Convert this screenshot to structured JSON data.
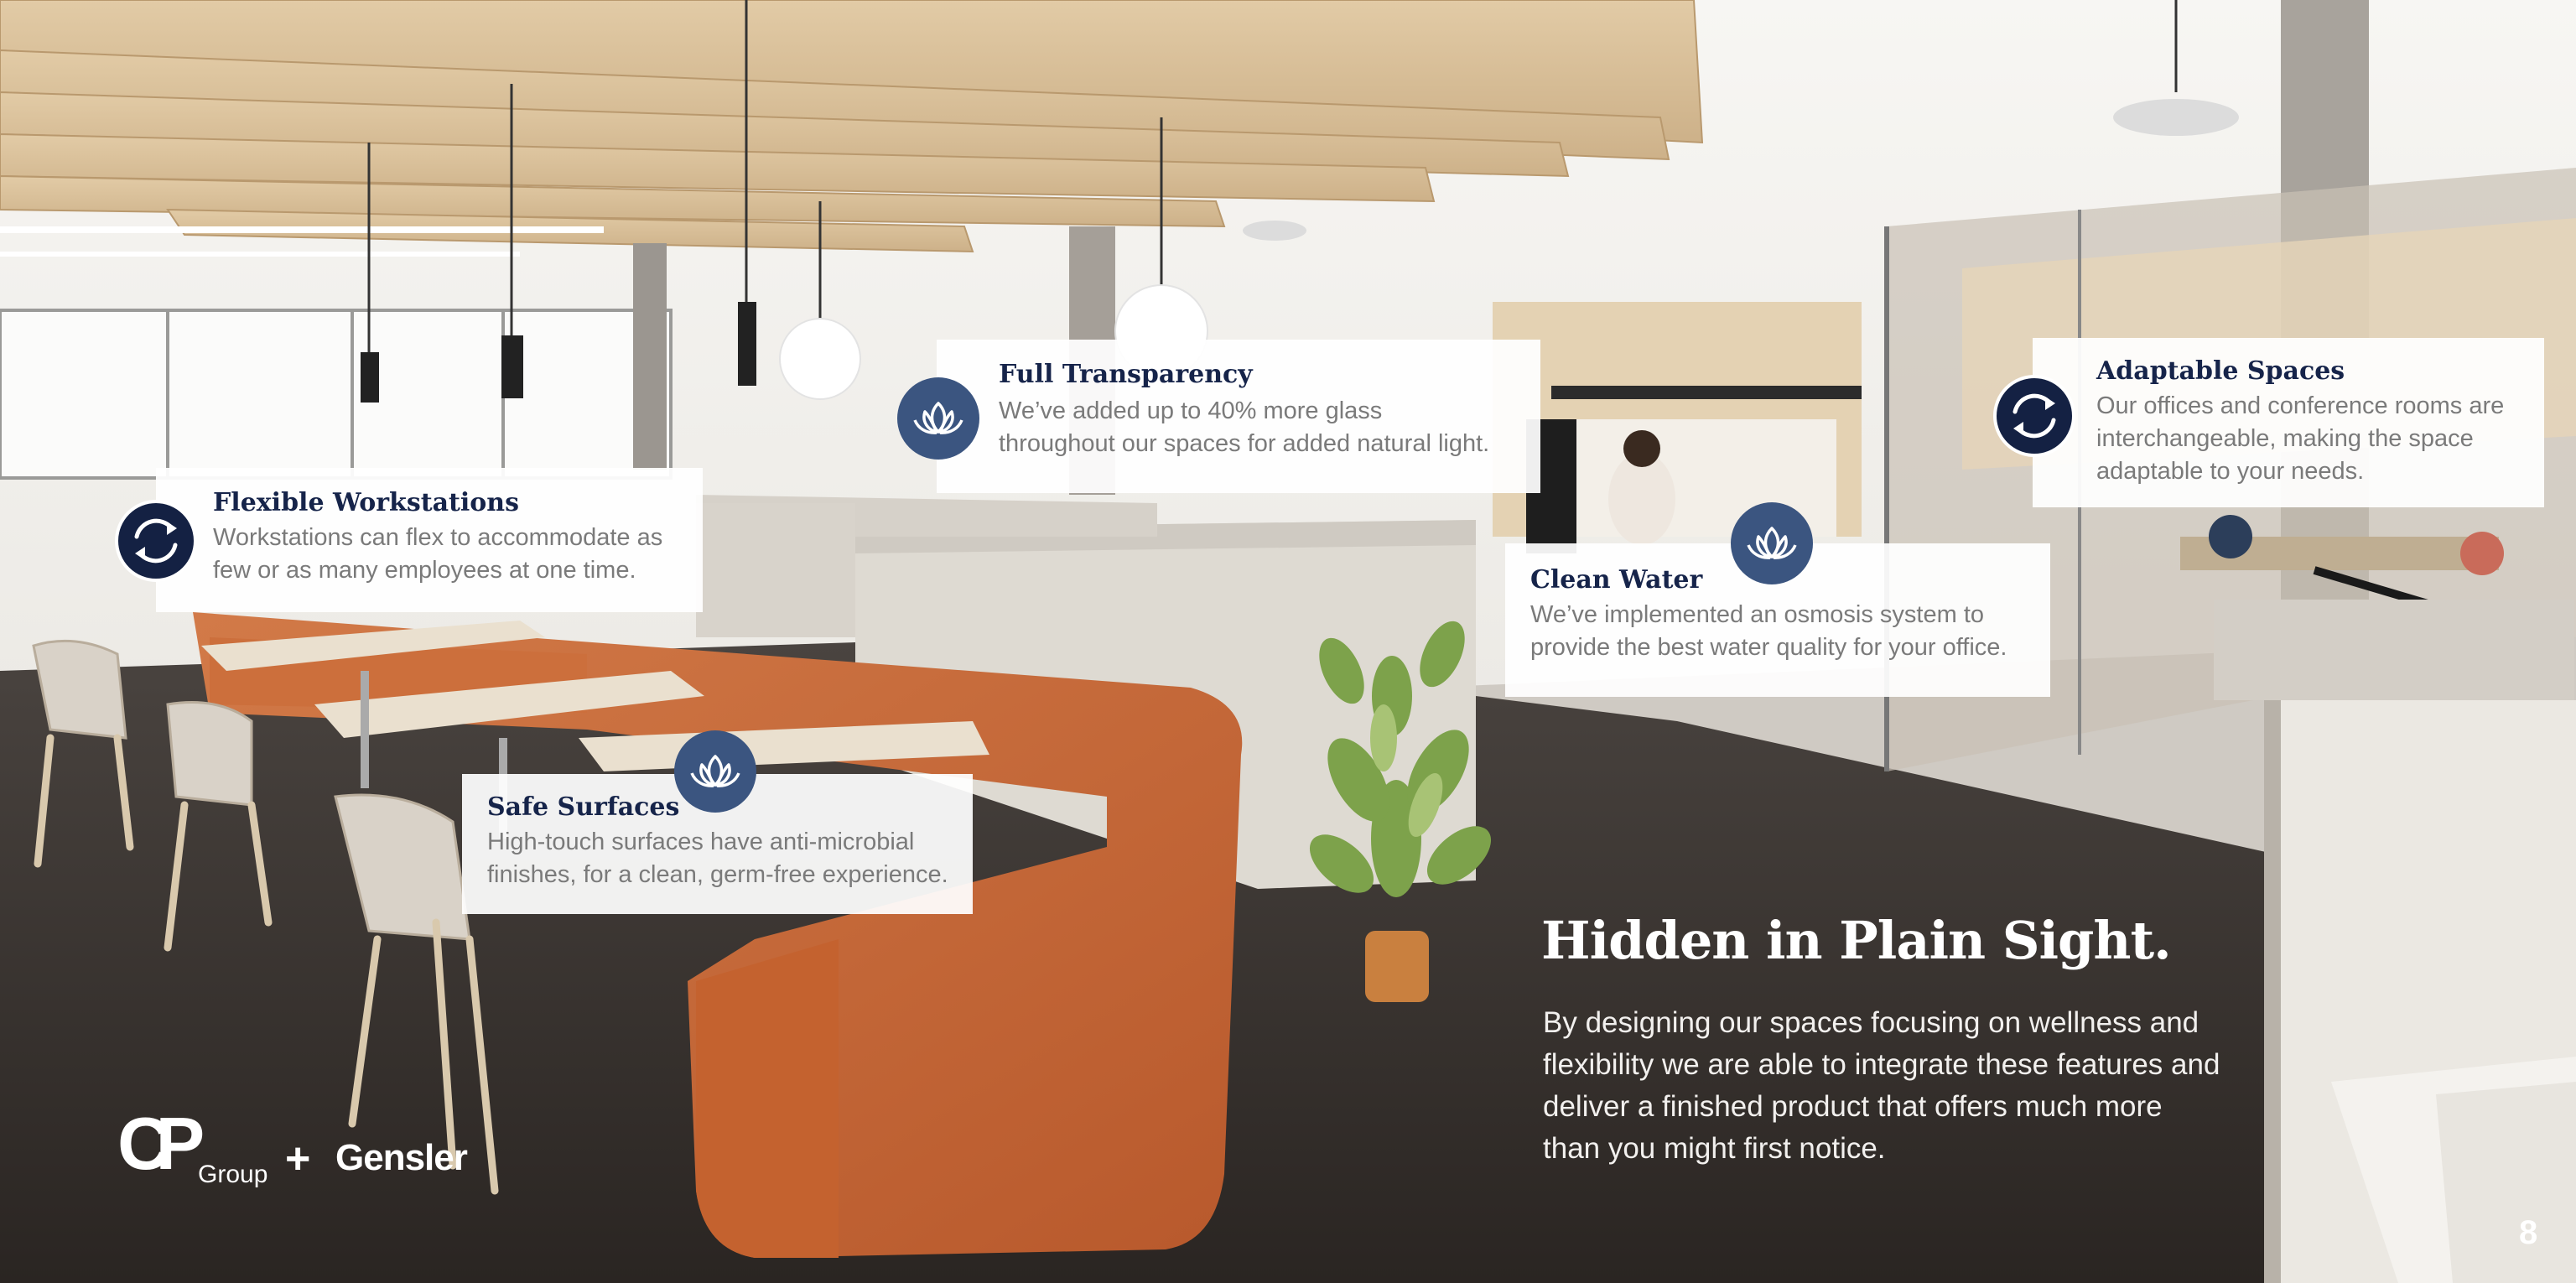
{
  "features": [
    {
      "icon": "lotus-icon",
      "title": "Full Transparency",
      "lines": [
        "We’ve added up to 40% more glass",
        "throughout our spaces for added natural light."
      ]
    },
    {
      "icon": "refresh-cycle-icon",
      "title": "Adaptable Spaces",
      "lines": [
        "Our offices and conference rooms are",
        "interchangeable, making the space",
        "adaptable to your needs."
      ]
    },
    {
      "icon": "refresh-cycle-icon",
      "title": "Flexible Workstations",
      "lines": [
        "Workstations can flex to accommodate as",
        "few or as many employees at one time."
      ]
    },
    {
      "icon": "lotus-icon",
      "title": "Clean Water",
      "lines": [
        "We’ve implemented an osmosis system to",
        "provide the best water quality for your office."
      ]
    },
    {
      "icon": "lotus-icon",
      "title": "Safe Surfaces",
      "lines": [
        "High-touch surfaces have anti-microbial",
        "finishes, for a clean, germ-free experience."
      ]
    }
  ],
  "headline": "Hidden in Plain Sight.",
  "blurb": [
    "By designing our spaces focusing on wellness and",
    "flexibility we are able to integrate these features and",
    "deliver a finished product that offers much more",
    "than you might first notice."
  ],
  "logo": {
    "mark": "CP",
    "group": "Group",
    "plus": "+",
    "partner": "Gensler"
  },
  "page_number": "8",
  "colors": {
    "navy": "#16244a",
    "icon_blue": "#3b5580",
    "icon_navy": "#142143",
    "body_gray": "#7a7a7a",
    "sofa_orange": "#c8693a"
  }
}
